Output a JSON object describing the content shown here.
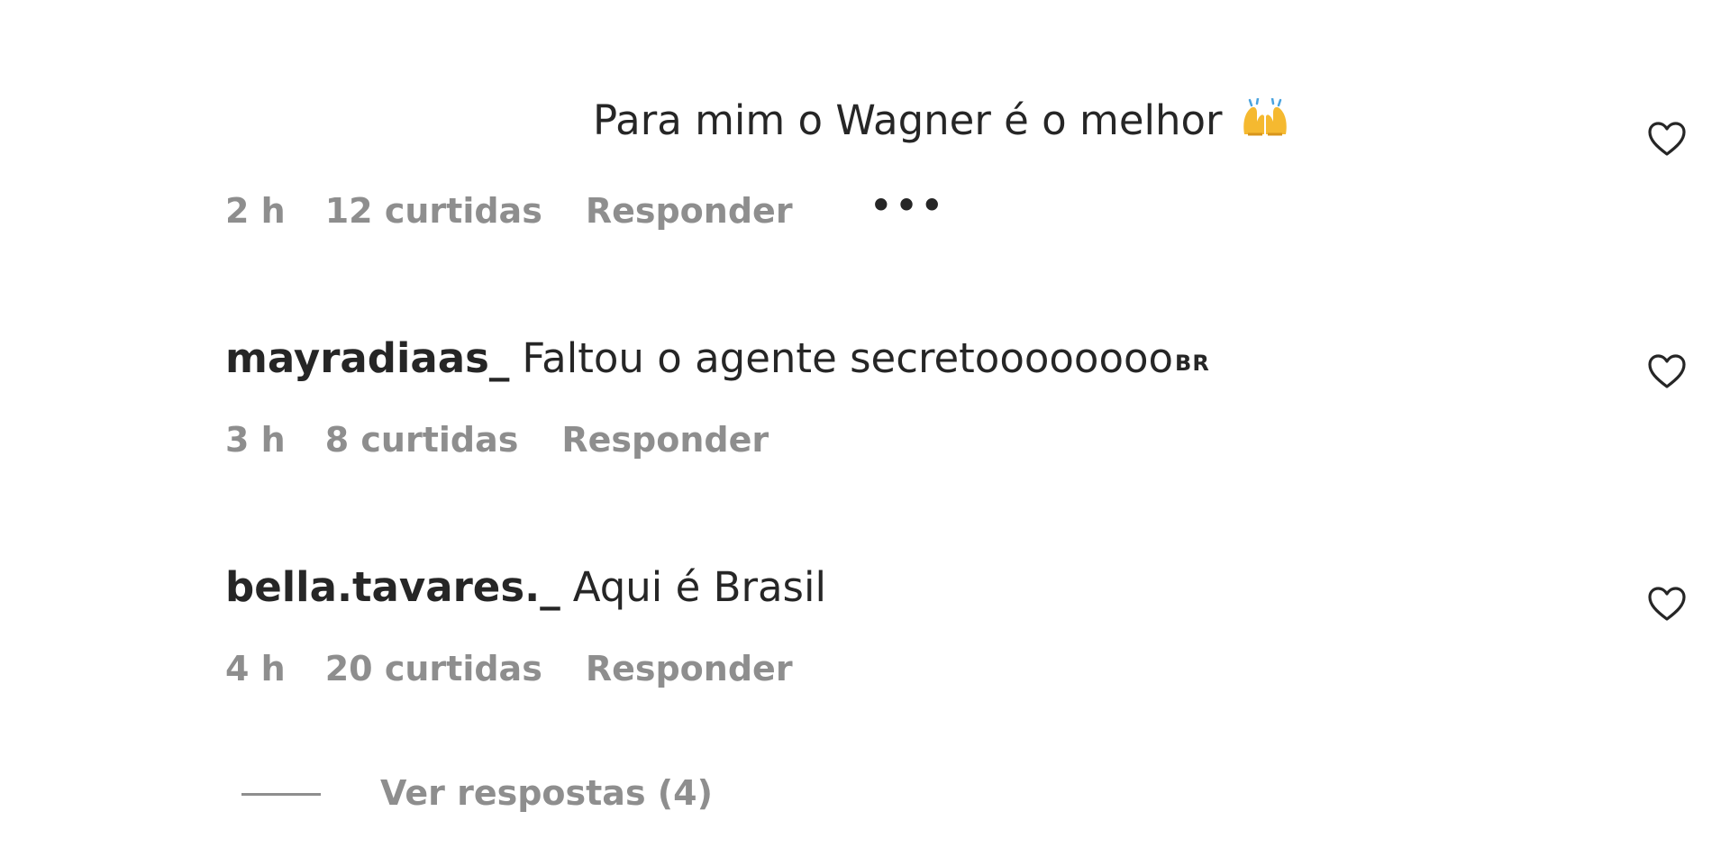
{
  "comments": [
    {
      "username": "",
      "text": "Para mim o Wagner é o melhor",
      "emoji": "raising-hands-emoji",
      "time": "2 h",
      "likes": "12 curtidas",
      "reply_label": "Responder",
      "more_label": "•••"
    },
    {
      "username": "mayradiaas_",
      "text": "Faltou o agente secretoooooooo",
      "badge": "BR",
      "time": "3 h",
      "likes": "8 curtidas",
      "reply_label": "Responder"
    },
    {
      "username": "bella.tavares._",
      "text": "Aqui é Brasil",
      "time": "4 h",
      "likes": "20 curtidas",
      "reply_label": "Responder"
    }
  ],
  "view_replies": {
    "label": "Ver respostas (4)"
  },
  "icons": {
    "like": "heart-outline-icon"
  },
  "colors": {
    "primary_text": "#262626",
    "secondary_text": "#8e8e8e",
    "emoji": "#f5b930"
  }
}
